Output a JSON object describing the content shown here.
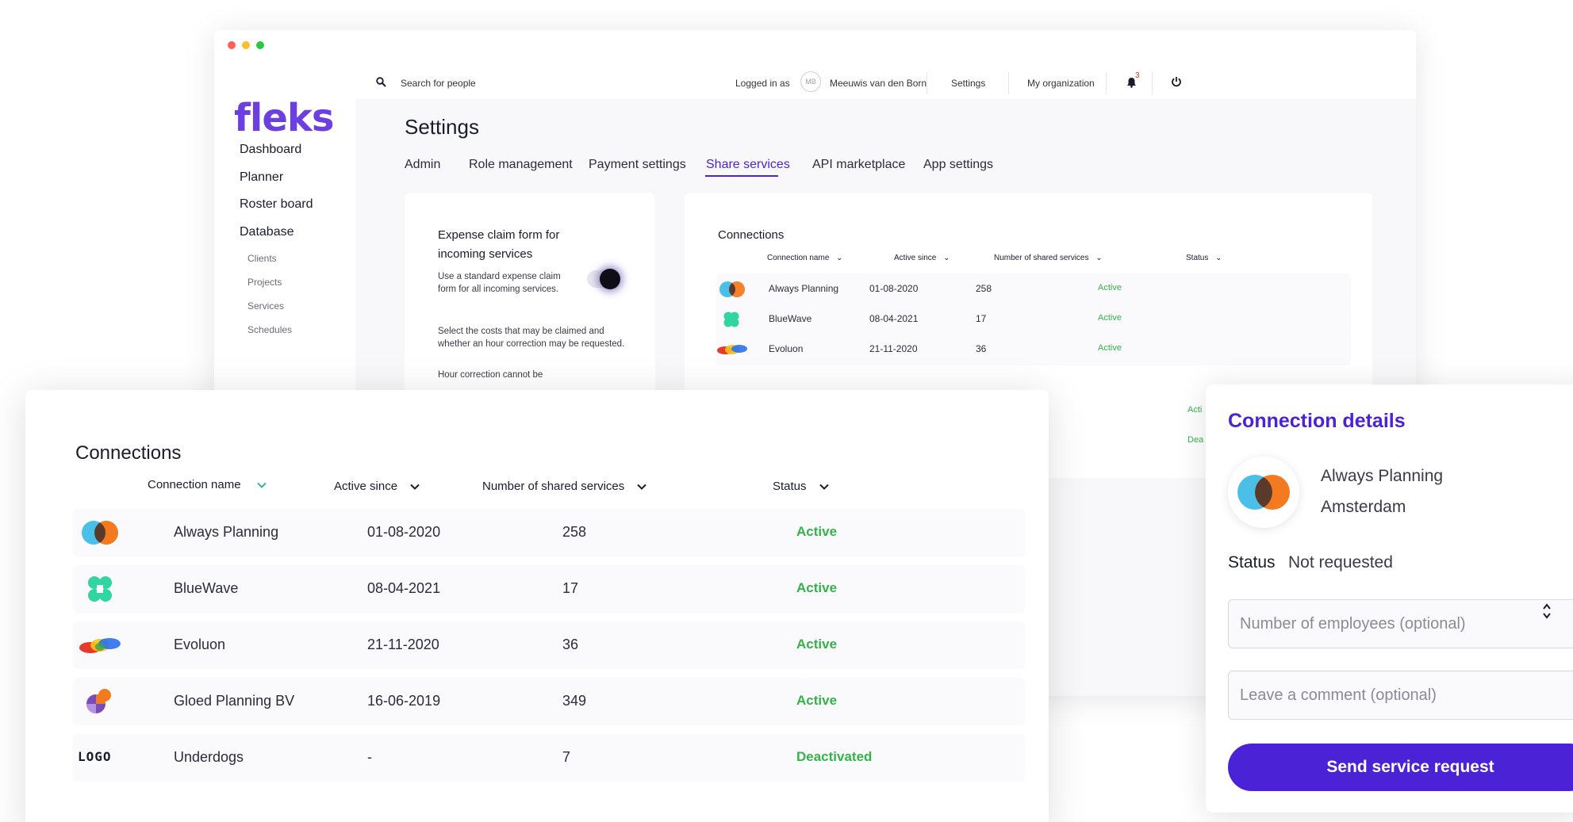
{
  "app": {
    "logo_text": "fleks",
    "brand_color": "#4b22d6"
  },
  "topbar": {
    "search_placeholder": "Search for people",
    "logged_in_label": "Logged in as",
    "avatar_initials": "MB",
    "user_name": "Meeuwis van den Born",
    "settings_link": "Settings",
    "org_link": "My organization",
    "notification_count": "3"
  },
  "sidebar": {
    "items": [
      "Dashboard",
      "Planner",
      "Roster board",
      "Database"
    ],
    "subitems": [
      "Clients",
      "Projects",
      "Services",
      "Schedules"
    ]
  },
  "settings": {
    "title": "Settings",
    "tabs": [
      "Admin",
      "Role management",
      "Payment settings",
      "Share services",
      "API marketplace",
      "App settings"
    ],
    "active_tab": "Share services"
  },
  "expense": {
    "title": "Expense claim form for incoming services",
    "toggle_text": "Use a standard expense claim form for all incoming services.",
    "select_text": "Select the costs that may be claimed and whether an hour correction may be requested.",
    "hidden_text": "Hour correction cannot be",
    "toggle_on": true
  },
  "connections_small": {
    "title": "Connections",
    "headers": [
      "Connection name",
      "Active since",
      "Number of shared services",
      "Status"
    ],
    "rows": [
      {
        "name": "Always Planning",
        "since": "01-08-2020",
        "count": "258",
        "status": "Active"
      },
      {
        "name": "BlueWave",
        "since": "08-04-2021",
        "count": "17",
        "status": "Active"
      },
      {
        "name": "Evoluon",
        "since": "21-11-2020",
        "count": "36",
        "status": "Active"
      }
    ],
    "partial_status": [
      "Acti",
      "Dea"
    ]
  },
  "connections": {
    "title": "Connections",
    "headers": [
      "Connection name",
      "Active since",
      "Number of shared services",
      "Status"
    ],
    "rows": [
      {
        "name": "Always Planning",
        "since": "01-08-2020",
        "count": "258",
        "status": "Active",
        "logo": "always-planning-logo"
      },
      {
        "name": "BlueWave",
        "since": "08-04-2021",
        "count": "17",
        "status": "Active",
        "logo": "bluewave-logo"
      },
      {
        "name": "Evoluon",
        "since": "21-11-2020",
        "count": "36",
        "status": "Active",
        "logo": "evoluon-logo"
      },
      {
        "name": "Gloed Planning BV",
        "since": "16-06-2019",
        "count": "349",
        "status": "Active",
        "logo": "gloed-logo"
      },
      {
        "name": "Underdogs",
        "since": "-",
        "count": "7",
        "status": "Deactivated",
        "logo": "logo-text-logo"
      }
    ],
    "logo_text": "LOGO",
    "status_color": "#35b34a"
  },
  "details": {
    "title": "Connection details",
    "company": "Always Planning",
    "city": "Amsterdam",
    "status_label": "Status",
    "status_value": "Not requested",
    "employees_placeholder": "Number of employees (optional)",
    "comment_placeholder": "Leave a comment (optional)",
    "send_label": "Send service request"
  }
}
